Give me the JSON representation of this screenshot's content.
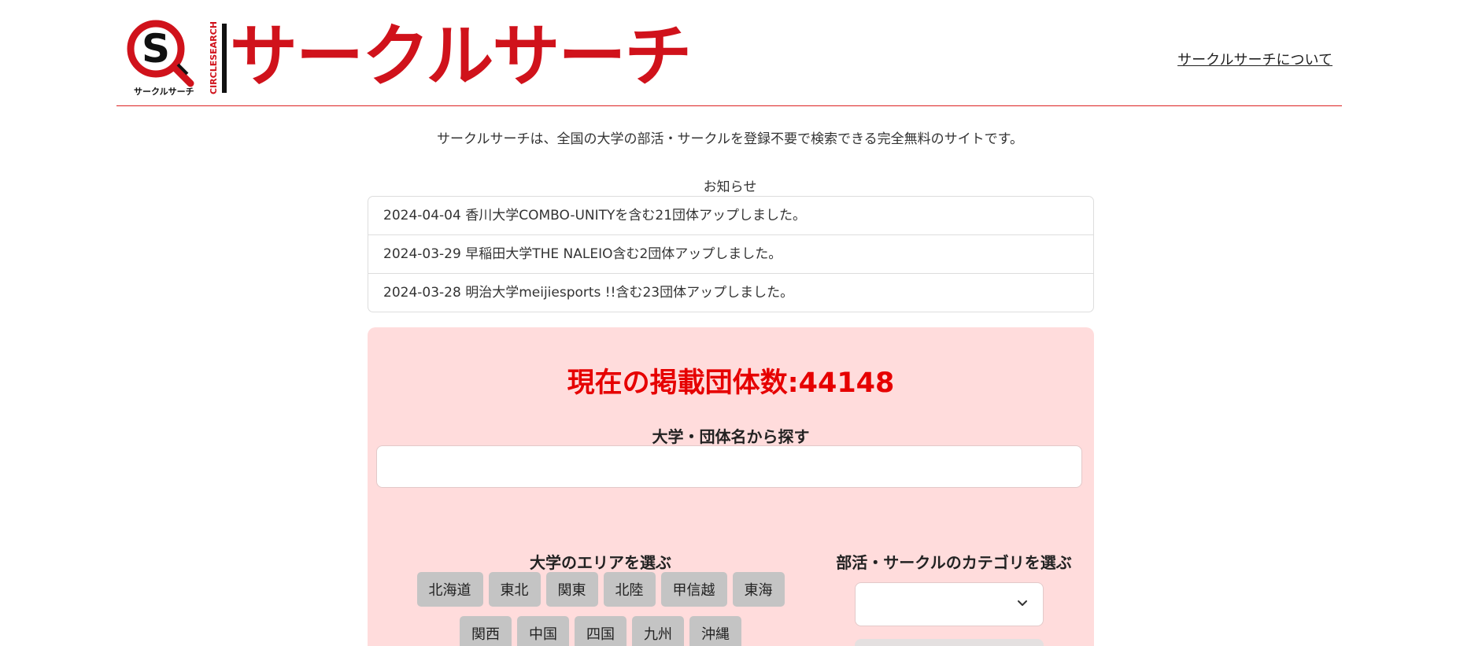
{
  "header": {
    "logo_title": "サークルサーチ",
    "logo_letter": "S",
    "logo_small_text": "サークルサーチ",
    "logo_vertical_text": "CIRCLESEARCH",
    "about_link": "サークルサーチについて"
  },
  "intro": "サークルサーチは、全国の大学の部活・サークルを登録不要で検索できる完全無料のサイトです。",
  "news": {
    "heading": "お知らせ",
    "items": [
      "2024-04-04 香川大学COMBO-UNITYを含む21団体アップしました。",
      "2024-03-29 早稲田大学THE NALEIO含む2団体アップしました。",
      "2024-03-28 明治大学meijiesports !!含む23団体アップしました。"
    ]
  },
  "search": {
    "count_title": "現在の掲載団体数:44148",
    "name_label": "大学・団体名から探す",
    "name_value": "",
    "name_placeholder": "",
    "area_label": "大学のエリアを選ぶ",
    "areas": [
      "北海道",
      "東北",
      "関東",
      "北陸",
      "甲信越",
      "東海",
      "関西",
      "中国",
      "四国",
      "九州",
      "沖縄"
    ],
    "category_label": "部活・サークルのカテゴリを選ぶ",
    "category_value": ""
  },
  "colors": {
    "brand_red": "#d0121b",
    "count_red": "#e60000",
    "panel_pink": "#ffdcdc",
    "area_button_gray": "#c4c4c4"
  },
  "icons": {
    "logo": "magnifier-s-logo-icon",
    "select": "chevron-down-icon"
  }
}
